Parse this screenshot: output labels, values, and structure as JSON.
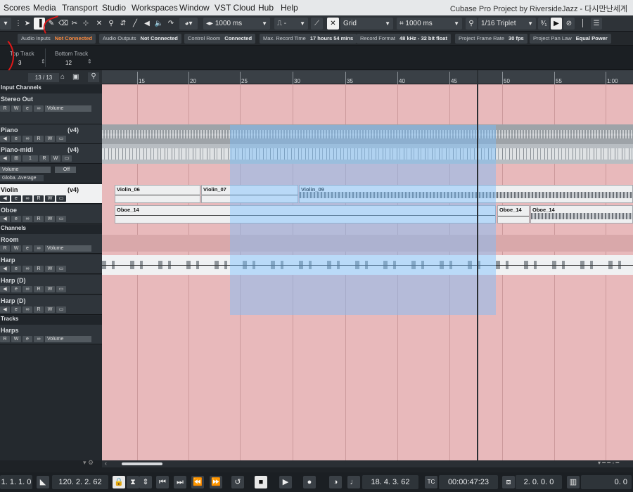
{
  "menu": {
    "items": [
      "Scores",
      "Media",
      "Transport",
      "Studio",
      "Workspaces",
      "Window",
      "VST Cloud",
      "Hub",
      "Help"
    ],
    "title": "Cubase Pro Project by RiversideJazz - 다시만난세계"
  },
  "toolbar": {
    "nudge": "1000 ms",
    "squelch": "-",
    "snap_type": "Grid",
    "grid_value": "1000 ms",
    "quantize": "1/16 Triplet"
  },
  "info": [
    {
      "label": "Audio Inputs",
      "value": "Not Connected",
      "warn": true
    },
    {
      "label": "Audio Outputs",
      "value": "Not Connected",
      "warn": false
    },
    {
      "label": "Control Room",
      "value": "Connected",
      "warn": false
    },
    {
      "label": "Max. Record Time",
      "value": "17 hours 54 mins",
      "warn": false
    },
    {
      "label": "Record Format",
      "value": "48 kHz - 32 bit float",
      "warn": false
    },
    {
      "label": "Project Frame Rate",
      "value": "30 fps",
      "warn": false
    },
    {
      "label": "Project Pan Law",
      "value": "Equal Power",
      "warn": false
    }
  ],
  "track_range": {
    "top_label": "Top Track",
    "top_value": "3",
    "bottom_label": "Bottom Track",
    "bottom_value": "12"
  },
  "track_count": "13 / 13",
  "tracks": [
    {
      "kind": "folder",
      "name": "Input Channels"
    },
    {
      "kind": "track",
      "name": "Stereo Out",
      "version": "",
      "vol": "Volume"
    },
    {
      "kind": "track",
      "name": "Piano",
      "version": "(v4)",
      "vol": ""
    },
    {
      "kind": "track",
      "name": "Piano-midi",
      "version": "(v4)",
      "vol": "",
      "num": "1"
    },
    {
      "kind": "sub",
      "vol_label": "Volume",
      "off": "Off",
      "extra": "Globa..Average"
    },
    {
      "kind": "track",
      "name": "Violin",
      "version": "(v4)",
      "vol": "",
      "selected": true
    },
    {
      "kind": "track",
      "name": "Oboe",
      "version": "",
      "vol": ""
    },
    {
      "kind": "folder",
      "name": "Channels"
    },
    {
      "kind": "track",
      "name": "Room",
      "version": "",
      "vol": "Volume"
    },
    {
      "kind": "track",
      "name": "Harp",
      "version": "",
      "vol": ""
    },
    {
      "kind": "track",
      "name": "Harp (D)",
      "version": "",
      "vol": ""
    },
    {
      "kind": "track",
      "name": "Harp (D)",
      "version": "",
      "vol": ""
    },
    {
      "kind": "folder",
      "name": "Tracks"
    },
    {
      "kind": "track",
      "name": "Harps",
      "version": "",
      "vol": "Volume"
    }
  ],
  "ruler": [
    "15",
    "20",
    "25",
    "30",
    "35",
    "40",
    "45",
    "50",
    "55",
    "1:00"
  ],
  "events": {
    "violin": [
      "Violin_06",
      "Violin_07",
      "Violin_09"
    ],
    "oboe": [
      "Oboe_14",
      "Oboe_14",
      "Oboe_14"
    ]
  },
  "transport": {
    "left": "1. 1. 1. 0",
    "position": "120. 2. 2. 62",
    "right": "18. 4. 3. 62",
    "time": "00:00:47:23",
    "end": "2. 0. 0. 0",
    "last": "0. 0"
  }
}
